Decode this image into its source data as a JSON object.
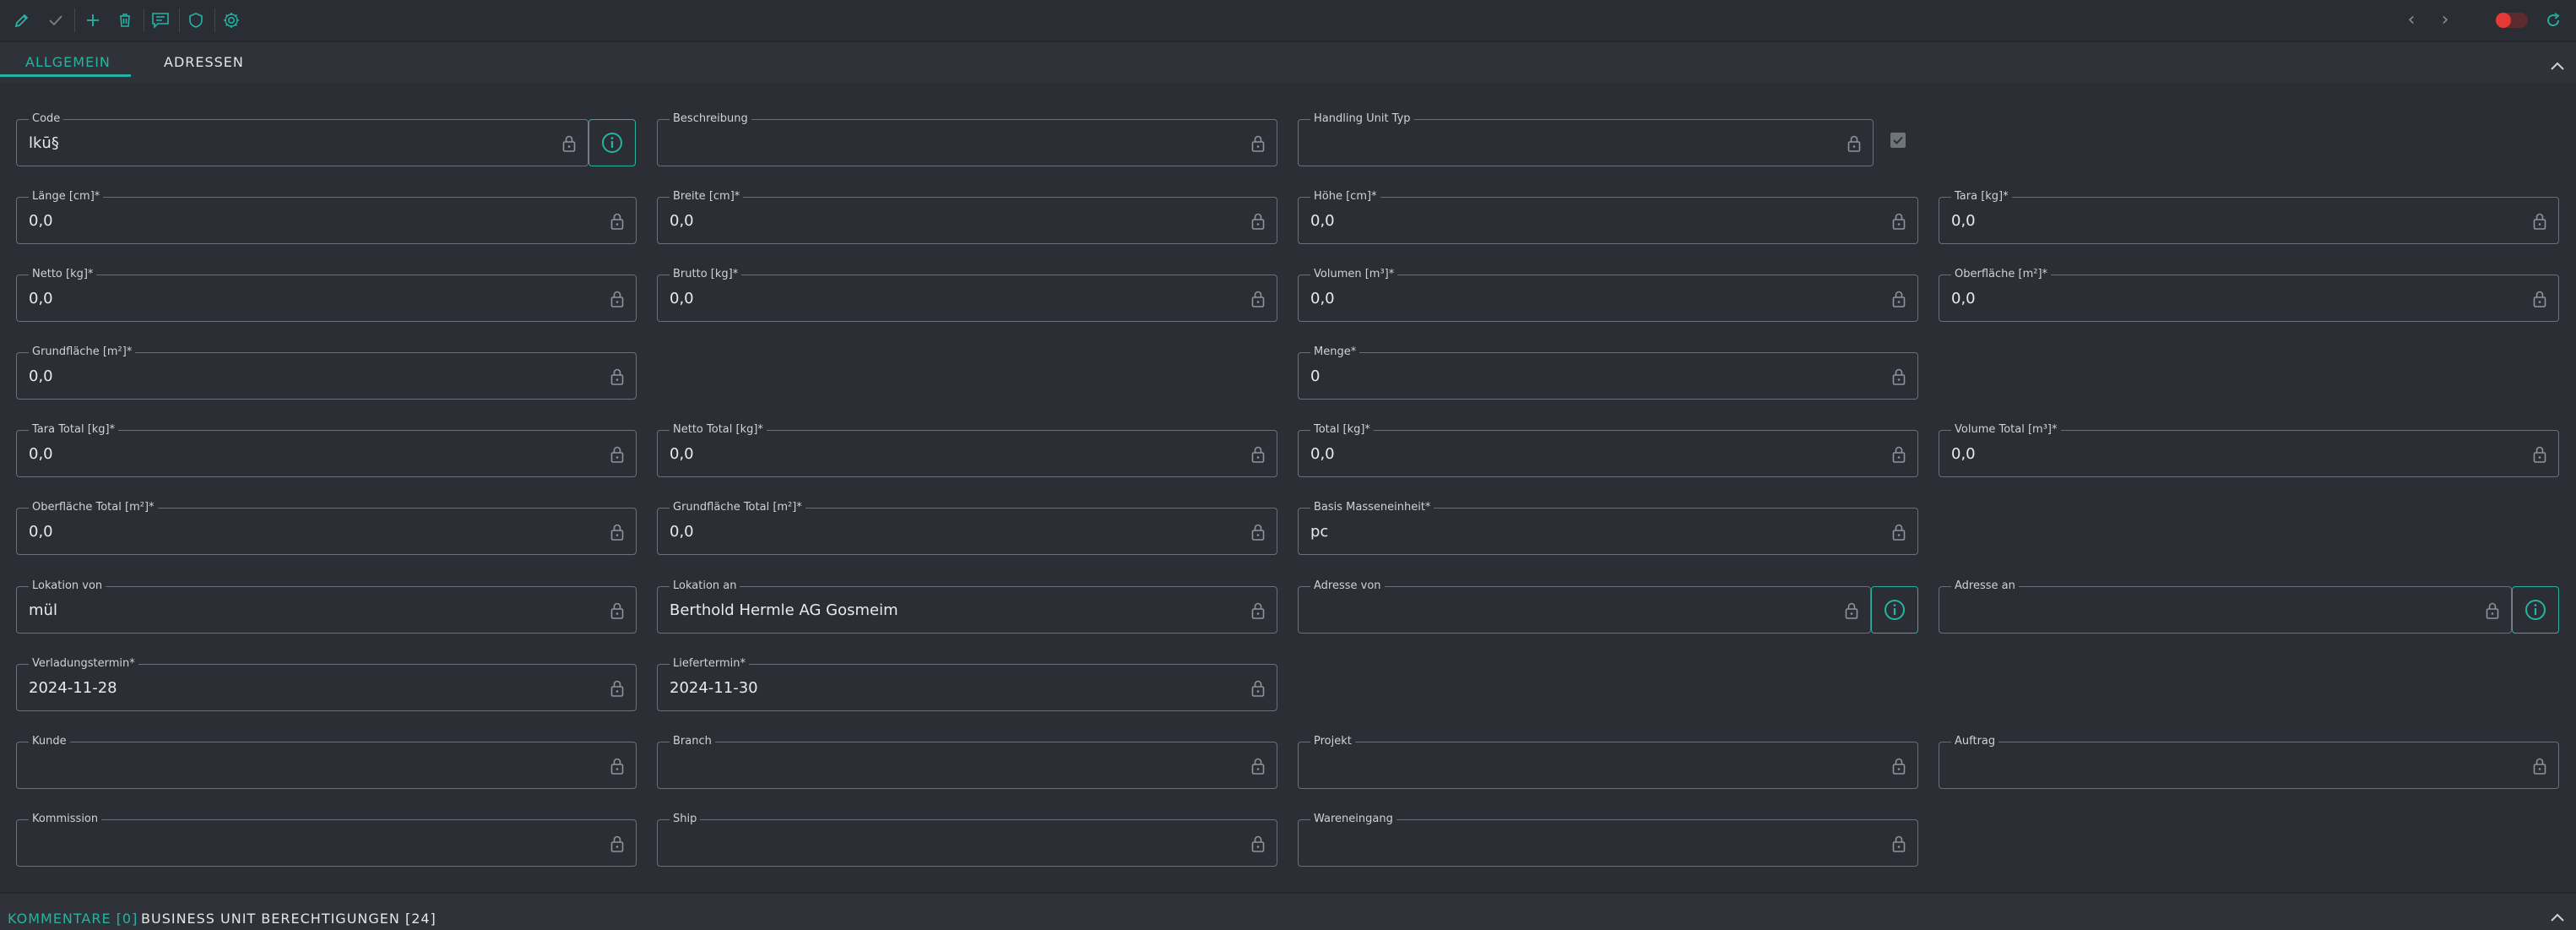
{
  "toolbar": {
    "buttons": [
      {
        "name": "edit-button",
        "icon": "pencil-icon"
      },
      {
        "name": "confirm-button",
        "icon": "check-icon"
      },
      {
        "name": "add-button",
        "icon": "plus-icon"
      },
      {
        "name": "delete-button",
        "icon": "trash-icon"
      },
      {
        "name": "comments-button",
        "icon": "comment-icon"
      },
      {
        "name": "permissions-button",
        "icon": "shield-icon"
      },
      {
        "name": "settings-button",
        "icon": "gear-icon"
      }
    ],
    "nav": {
      "prev": "‹",
      "next": "›"
    },
    "accent_color": "#26b3a3",
    "toggle_color": "#e53935"
  },
  "tabs": [
    {
      "label": "ALLGEMEIN",
      "active": true
    },
    {
      "label": "ADRESSEN",
      "active": false
    }
  ],
  "fields": {
    "code": {
      "label": "Code",
      "value": "lkū§"
    },
    "beschreibung": {
      "label": "Beschreibung",
      "value": ""
    },
    "handling_unit_typ": {
      "label": "Handling Unit Typ",
      "value": ""
    },
    "laenge": {
      "label": "Länge [cm]*",
      "value": "0,0"
    },
    "breite": {
      "label": "Breite [cm]*",
      "value": "0,0"
    },
    "hoehe": {
      "label": "Höhe [cm]*",
      "value": "0,0"
    },
    "tara": {
      "label": "Tara [kg]*",
      "value": "0,0"
    },
    "netto": {
      "label": "Netto [kg]*",
      "value": "0,0"
    },
    "brutto": {
      "label": "Brutto [kg]*",
      "value": "0,0"
    },
    "volumen": {
      "label": "Volumen [m³]*",
      "value": "0,0"
    },
    "oberflaeche": {
      "label": "Oberfläche [m²]*",
      "value": "0,0"
    },
    "grundflaeche": {
      "label": "Grundfläche [m²]*",
      "value": "0,0"
    },
    "menge": {
      "label": "Menge*",
      "value": "0"
    },
    "tara_total": {
      "label": "Tara Total [kg]*",
      "value": "0,0"
    },
    "netto_total": {
      "label": "Netto Total [kg]*",
      "value": "0,0"
    },
    "total": {
      "label": "Total [kg]*",
      "value": "0,0"
    },
    "volume_total": {
      "label": "Volume Total [m³]*",
      "value": "0,0"
    },
    "oberflaeche_total": {
      "label": "Oberfläche Total [m²]*",
      "value": "0,0"
    },
    "grundflaeche_total": {
      "label": "Grundfläche Total [m²]*",
      "value": "0,0"
    },
    "basis_masseneinheit": {
      "label": "Basis Masseneinheit*",
      "value": "pc"
    },
    "lokation_von": {
      "label": "Lokation von",
      "value": "mül"
    },
    "lokation_an": {
      "label": "Lokation an",
      "value": "Berthold Hermle AG Gosmeim"
    },
    "adresse_von": {
      "label": "Adresse von",
      "value": ""
    },
    "adresse_an": {
      "label": "Adresse an",
      "value": ""
    },
    "verladungstermin": {
      "label": "Verladungstermin*",
      "value": "2024-11-28"
    },
    "liefertermin": {
      "label": "Liefertermin*",
      "value": "2024-11-30"
    },
    "kunde": {
      "label": "Kunde",
      "value": ""
    },
    "branch": {
      "label": "Branch",
      "value": ""
    },
    "projekt": {
      "label": "Projekt",
      "value": ""
    },
    "auftrag": {
      "label": "Auftrag",
      "value": ""
    },
    "kommission": {
      "label": "Kommission",
      "value": ""
    },
    "ship": {
      "label": "Ship",
      "value": ""
    },
    "wareneingang": {
      "label": "Wareneingang",
      "value": ""
    }
  },
  "bottom_tabs": [
    {
      "label": "KOMMENTARE [0]",
      "active": true
    },
    {
      "label": "BUSINESS UNIT BERECHTIGUNGEN [24]",
      "active": false
    }
  ]
}
